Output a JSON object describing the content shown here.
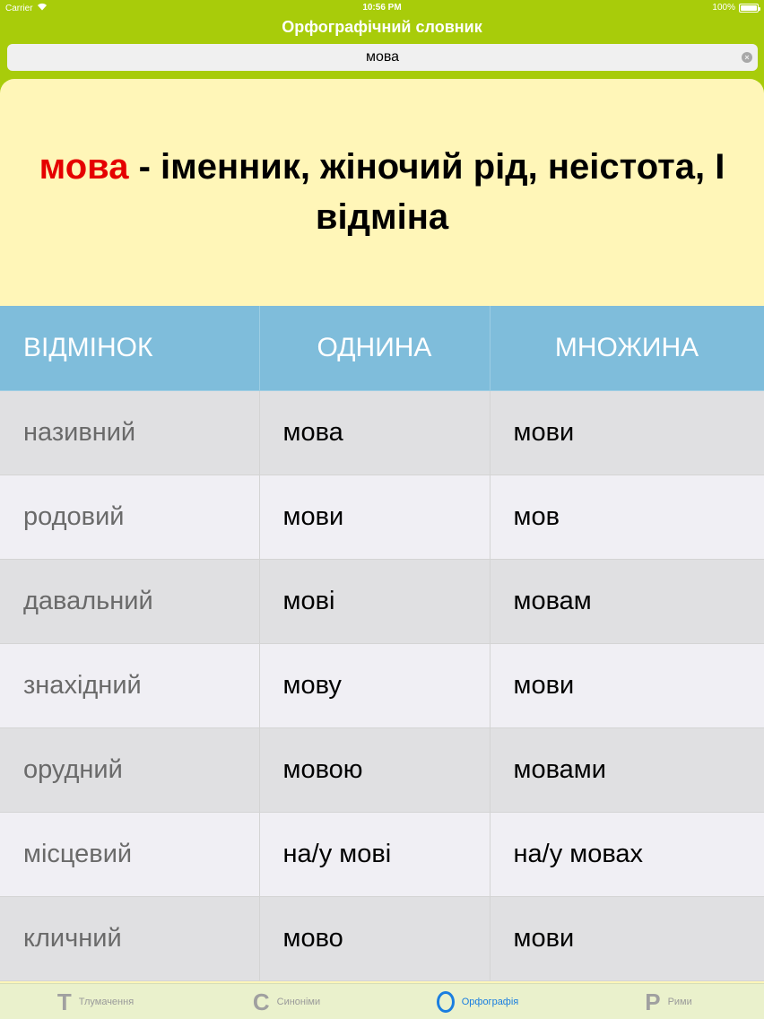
{
  "status_bar": {
    "carrier": "Carrier",
    "time": "10:56 PM",
    "battery": "100%"
  },
  "nav": {
    "title": "Орфографічний словник"
  },
  "search": {
    "value": "мова",
    "placeholder": ""
  },
  "entry": {
    "word": "мова",
    "description": " - іменник, жіночий рід, неістота, I відміна"
  },
  "table": {
    "headers": [
      "ВІДМІНОК",
      "ОДНИНА",
      "МНОЖИНА"
    ],
    "rows": [
      [
        "називний",
        "мова",
        "мови"
      ],
      [
        "родовий",
        "мови",
        "мов"
      ],
      [
        "давальний",
        "мові",
        "мовам"
      ],
      [
        "знахідний",
        "мову",
        "мови"
      ],
      [
        "орудний",
        "мовою",
        "мовами"
      ],
      [
        "місцевий",
        "на/у мові",
        "на/у мовах"
      ],
      [
        "кличний",
        "мово",
        "мови"
      ]
    ]
  },
  "tabs": [
    {
      "icon": "Т",
      "label": "Тлумачення",
      "active": false
    },
    {
      "icon": "С",
      "label": "Синоніми",
      "active": false
    },
    {
      "icon": "О",
      "label": "Орфографія",
      "active": true
    },
    {
      "icon": "Р",
      "label": "Рими",
      "active": false
    }
  ],
  "colors": {
    "nav_bg": "#a8cc0a",
    "card_bg": "#fff6b8",
    "header_bg": "#7fbddb",
    "word": "#e50000",
    "active_tab": "#1a7ee0"
  }
}
